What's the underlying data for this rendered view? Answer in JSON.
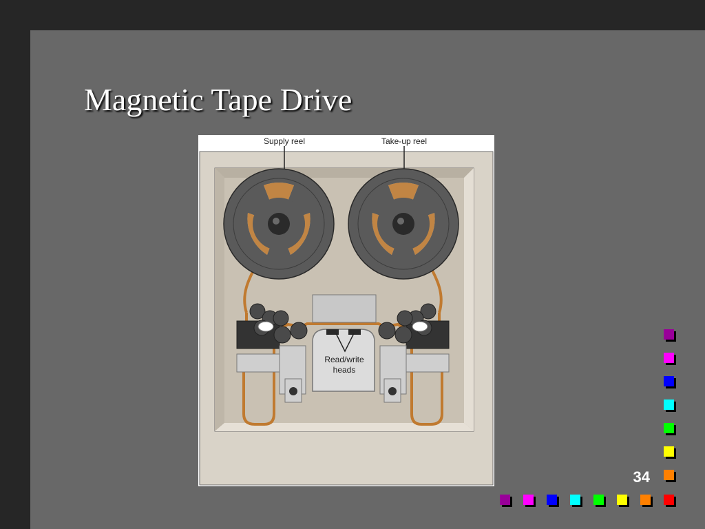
{
  "slide": {
    "title": "Magnetic Tape Drive",
    "page_number": "34"
  },
  "diagram": {
    "labels": {
      "supply_reel": "Supply reel",
      "takeup_reel": "Take-up reel",
      "heads_line1": "Read/write",
      "heads_line2": "heads"
    }
  },
  "colors": {
    "background_dark": "#262626",
    "background_main": "#686868",
    "tape": "#c07a30",
    "reel": "#5a5a5a",
    "cabinet": "#d4cdc0",
    "square_colors": [
      "#990099",
      "#ff00ff",
      "#0000ff",
      "#00ffff",
      "#00ff00",
      "#ffff00",
      "#ff8000",
      "#ff0000"
    ]
  }
}
